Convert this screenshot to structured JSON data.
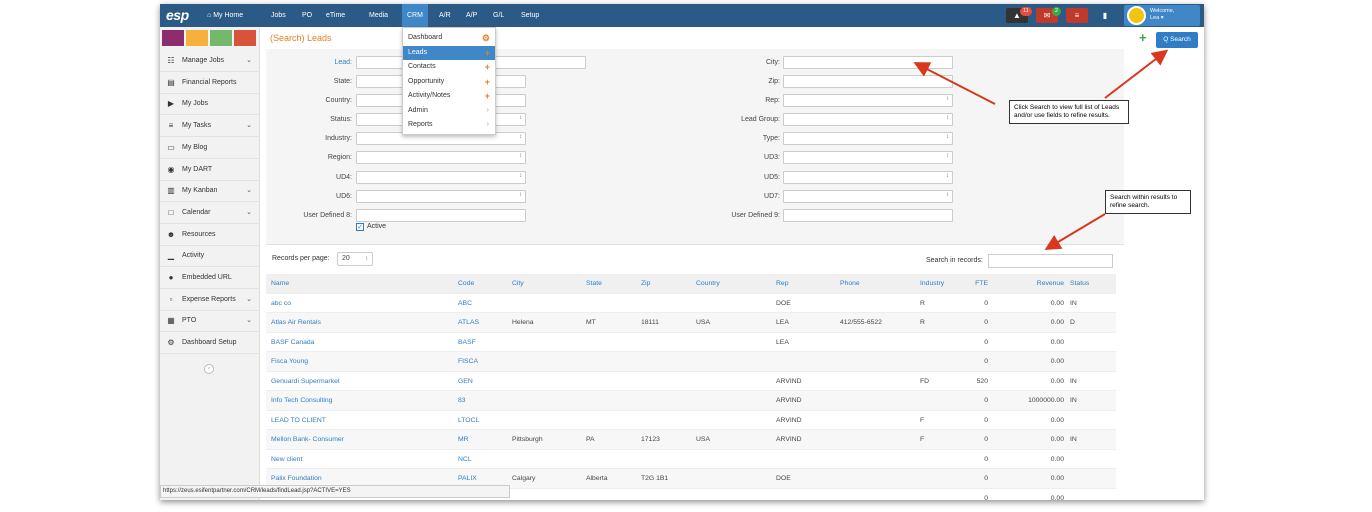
{
  "app": {
    "logo": "esp",
    "nav": [
      "My Home",
      "Jobs",
      "PO",
      "eTime",
      "Media",
      "CRM",
      "A/R",
      "A/P",
      "G/L",
      "Setup"
    ],
    "notifications": {
      "bell_count": "11",
      "mail_count": "2"
    },
    "welcome": "Welcome,",
    "user": "Lea"
  },
  "sidebar": {
    "swatch_colors": [
      "#8e2d6e",
      "#f6b13d",
      "#73b86b",
      "#d9533c"
    ],
    "items": [
      {
        "label": "Manage Jobs",
        "icon": "org-chart-icon",
        "glyph": "☷",
        "chevron": true
      },
      {
        "label": "Financial Reports",
        "icon": "report-icon",
        "glyph": "▤",
        "chevron": false
      },
      {
        "label": "My Jobs",
        "icon": "folder-icon",
        "glyph": "▶",
        "chevron": false
      },
      {
        "label": "My Tasks",
        "icon": "tasks-icon",
        "glyph": "≡",
        "chevron": true
      },
      {
        "label": "My Blog",
        "icon": "comment-icon",
        "glyph": "▭",
        "chevron": false
      },
      {
        "label": "My DART",
        "icon": "dart-icon",
        "glyph": "◉",
        "chevron": false
      },
      {
        "label": "My Kanban",
        "icon": "map-icon",
        "glyph": "▥",
        "chevron": true
      },
      {
        "label": "Calendar",
        "icon": "calendar-icon",
        "glyph": "□",
        "chevron": true
      },
      {
        "label": "Resources",
        "icon": "users-icon",
        "glyph": "☻",
        "chevron": false
      },
      {
        "label": "Activity",
        "icon": "signal-icon",
        "glyph": "▁",
        "chevron": false
      },
      {
        "label": "Embedded URL",
        "icon": "globe-icon",
        "glyph": "●",
        "chevron": false
      },
      {
        "label": "Expense Reports",
        "icon": "money-icon",
        "glyph": "▫",
        "chevron": true
      },
      {
        "label": "PTO",
        "icon": "calendar-grid-icon",
        "glyph": "▦",
        "chevron": true
      },
      {
        "label": "Dashboard Setup",
        "icon": "cogs-icon",
        "glyph": "⚙",
        "chevron": false
      }
    ]
  },
  "page": {
    "title": "(Search) Leads",
    "add_icon": "+",
    "search_button": "Q Search"
  },
  "filters": {
    "left": [
      "Lead:",
      "State:",
      "Country:",
      "Status:",
      "Industry:",
      "Region:",
      "UD4:",
      "UD6:",
      "User Defined 8:"
    ],
    "right": [
      "City:",
      "Zip:",
      "Rep:",
      "Lead Group:",
      "Type:",
      "UD3:",
      "UD5:",
      "UD7:",
      "User Defined 9:"
    ],
    "active_label": "Active",
    "active_checked": true
  },
  "crm_menu": [
    {
      "label": "Dashboard",
      "suffix": "gear"
    },
    {
      "label": "Leads",
      "suffix": "plus"
    },
    {
      "label": "Contacts",
      "suffix": "plus"
    },
    {
      "label": "Opportunity",
      "suffix": "plus"
    },
    {
      "label": "Activity/Notes",
      "suffix": "plus"
    },
    {
      "label": "Admin",
      "suffix": "arrow"
    },
    {
      "label": "Reports",
      "suffix": "arrow"
    }
  ],
  "records": {
    "per_page_label": "Records per page:",
    "per_page_value": "20",
    "search_label": "Search in records:"
  },
  "table": {
    "headers": [
      "Name",
      "Code",
      "City",
      "State",
      "Zip",
      "Country",
      "Rep",
      "Phone",
      "Industry",
      "FTE",
      "Revenue",
      "Status"
    ],
    "rows": [
      [
        "abc co",
        "ABC",
        "",
        "",
        "",
        "",
        "DOE",
        "",
        "R",
        "0",
        "0.00",
        "IN"
      ],
      [
        "Atlas Air Rentals",
        "ATLAS",
        "Helena",
        "MT",
        "18111",
        "USA",
        "LEA",
        "412/555-6522",
        "R",
        "0",
        "0.00",
        "D"
      ],
      [
        "BASF Canada",
        "BASF",
        "",
        "",
        "",
        "",
        "LEA",
        "",
        "",
        "0",
        "0.00",
        ""
      ],
      [
        "Fisca Young",
        "FISCA",
        "",
        "",
        "",
        "",
        "",
        "",
        "",
        "0",
        "0.00",
        ""
      ],
      [
        "Genuardi Supermarket",
        "GEN",
        "",
        "",
        "",
        "",
        "ARVIND",
        "",
        "FD",
        "520",
        "0.00",
        "IN"
      ],
      [
        "Info Tech Consulting",
        "83",
        "",
        "",
        "",
        "",
        "ARVIND",
        "",
        "",
        "0",
        "1000000.00",
        "IN"
      ],
      [
        "LEAD TO CLIENT",
        "LTOCL",
        "",
        "",
        "",
        "",
        "ARVIND",
        "",
        "F",
        "0",
        "0.00",
        ""
      ],
      [
        "Mellon Bank- Consumer",
        "MR",
        "Pittsburgh",
        "PA",
        "17123",
        "USA",
        "ARVIND",
        "",
        "F",
        "0",
        "0.00",
        "IN"
      ],
      [
        "New client",
        "NCL",
        "",
        "",
        "",
        "",
        "",
        "",
        "",
        "0",
        "0.00",
        ""
      ],
      [
        "Palix Foundation",
        "PALIX",
        "Calgary",
        "Alberta",
        "T2G 1B1",
        "",
        "DOE",
        "",
        "",
        "0",
        "0.00",
        ""
      ],
      [
        "",
        "",
        "",
        "",
        "",
        "",
        "",
        "",
        "",
        "0",
        "0.00",
        ""
      ]
    ]
  },
  "status_url": "https://zeus.esifentpartner.com/CRM/leads/findLead.jsp?ACTIVE=YES",
  "callouts": {
    "search": "Click Search to view full list of Leads and/or use fields to refine results.",
    "within": "Search within results to refine search."
  },
  "colors": {
    "nav_bg": "#2c5a86",
    "accent": "#3f87c7",
    "title": "#e67e22",
    "link": "#2f7dc4",
    "arrow": "#d9381e"
  }
}
